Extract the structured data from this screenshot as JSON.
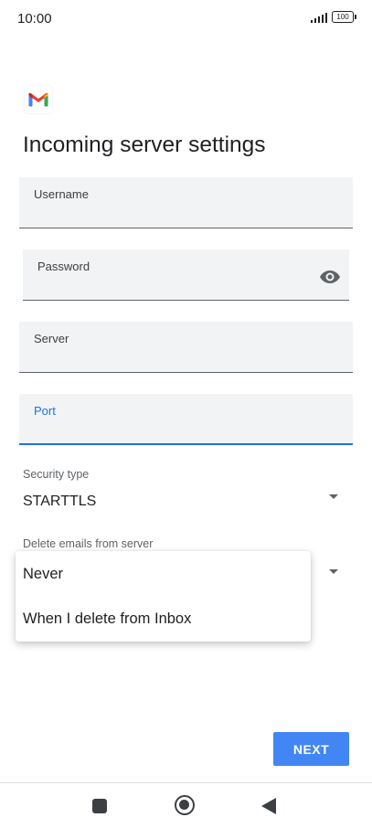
{
  "status_bar": {
    "time": "10:00",
    "battery": "100",
    "signal_icon": "signal-bars-icon",
    "battery_icon": "battery-icon"
  },
  "app": {
    "logo_icon": "gmail-logo-icon",
    "logo_colors": [
      "#4285F4",
      "#EA4335",
      "#FBBC04",
      "#34A853",
      "#C5221F"
    ]
  },
  "page": {
    "title": "Incoming server settings"
  },
  "form": {
    "username": {
      "label": "Username",
      "value": ""
    },
    "password": {
      "label": "Password",
      "value": "",
      "toggle_icon": "eye-icon"
    },
    "server": {
      "label": "Server",
      "value": ""
    },
    "port": {
      "label": "Port",
      "value": "",
      "focused": true
    },
    "security_type": {
      "label": "Security type",
      "value": "STARTTLS"
    },
    "delete_emails": {
      "label": "Delete emails from server",
      "options": [
        "Never",
        "When I delete from Inbox"
      ]
    }
  },
  "actions": {
    "next_label": "NEXT"
  },
  "nav": {
    "recents_icon": "square-icon",
    "home_icon": "home-circle-icon",
    "back_icon": "back-triangle-icon"
  },
  "colors": {
    "accent": "#1a73e8",
    "button": "#4285f4",
    "field_background": "#f1f3f4"
  }
}
